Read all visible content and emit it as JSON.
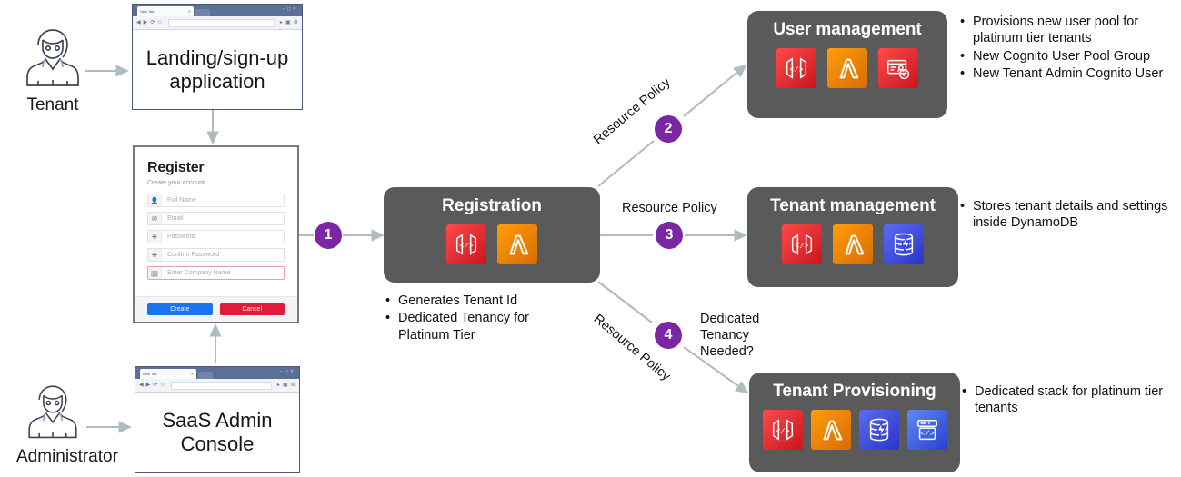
{
  "actors": [
    {
      "id": "tenant",
      "label": "Tenant",
      "icon": "person-icon"
    },
    {
      "id": "administrator",
      "label": "Administrator",
      "icon": "person-icon"
    }
  ],
  "browsers": [
    {
      "id": "landing",
      "tab_label": "New Tab",
      "title": "Landing/sign-up application"
    },
    {
      "id": "admin-console",
      "tab_label": "New Tab",
      "title": "SaaS Admin Console"
    }
  ],
  "register_form": {
    "title": "Register",
    "subtitle": "Create your account",
    "fields": [
      {
        "icon": "user-icon",
        "placeholder": "Full Name",
        "invalid": false
      },
      {
        "icon": "envelope-icon",
        "placeholder": "Email",
        "invalid": false
      },
      {
        "icon": "key-icon",
        "placeholder": "Password",
        "invalid": false
      },
      {
        "icon": "key-icon",
        "placeholder": "Confirm Password",
        "invalid": false
      },
      {
        "icon": "building-icon",
        "placeholder": "Enter Company Name",
        "invalid": true
      }
    ],
    "buttons": {
      "create": "Create",
      "cancel": "Cancel"
    }
  },
  "services": [
    {
      "id": "registration",
      "title": "Registration",
      "icons": [
        "api-gateway-icon",
        "lambda-icon"
      ],
      "bullets": [
        "Generates Tenant Id",
        "Dedicated Tenancy for Platinum Tier"
      ]
    },
    {
      "id": "user-management",
      "title": "User management",
      "icons": [
        "api-gateway-icon",
        "lambda-icon",
        "cognito-icon"
      ],
      "bullets": [
        "Provisions new user pool for platinum tier tenants",
        "New Cognito User Pool Group",
        "New Tenant Admin Cognito User"
      ]
    },
    {
      "id": "tenant-management",
      "title": "Tenant management",
      "icons": [
        "api-gateway-icon",
        "lambda-icon",
        "dynamodb-icon"
      ],
      "bullets": [
        "Stores tenant details and settings inside DynamoDB"
      ]
    },
    {
      "id": "tenant-provisioning",
      "title": "Tenant Provisioning",
      "icons": [
        "api-gateway-icon",
        "lambda-icon",
        "dynamodb-icon",
        "cloudformation-icon"
      ],
      "bullets": [
        "Dedicated stack for platinum tier tenants"
      ]
    }
  ],
  "flow": {
    "badges": [
      {
        "number": "1"
      },
      {
        "number": "2"
      },
      {
        "number": "3"
      },
      {
        "number": "4"
      }
    ],
    "labels": {
      "resource_policy_top": "Resource Policy",
      "resource_policy_mid": "Resource Policy",
      "resource_policy_bottom": "Resource Policy"
    },
    "notes": {
      "dedicated_tenancy": "Dedicated Tenancy Needed?"
    }
  },
  "colors": {
    "badge_purple": "#7b27a3",
    "service_gray": "#5a5a5a",
    "connector_gray": "#aebcc0",
    "apigw_red": "#c7161d",
    "lambda_orange": "#d96b04",
    "dynamodb_blue": "#2b34c9",
    "create_blue": "#1a73f0",
    "cancel_red": "#e21b38"
  }
}
